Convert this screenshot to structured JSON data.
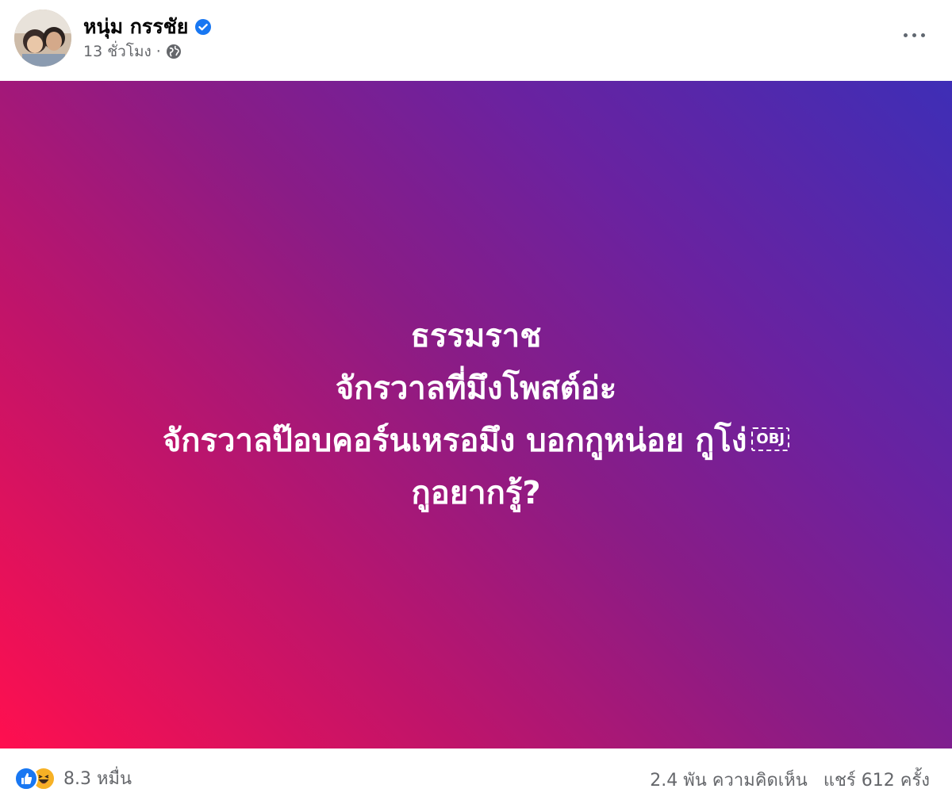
{
  "post": {
    "author": "หนุ่ม กรรชัย",
    "verified": true,
    "time": "13 ชั่วโมง",
    "separator": "·",
    "privacy_icon": "globe-icon",
    "more_icon": "more-horizontal-icon"
  },
  "media": {
    "background_colors": [
      "#ff0f4f",
      "#8a1c86",
      "#3e2eb6"
    ],
    "lines": [
      "ธรรมราช",
      "จักรวาลที่มึงโพสต์อ่ะ",
      "จักรวาลป๊อบคอร์นเหรอมึง บอกกูหน่อย กูโง่",
      "กูอยากรู้?"
    ],
    "obj_placeholder": "OBJ"
  },
  "footer": {
    "reaction_icons": [
      "like-icon",
      "haha-icon"
    ],
    "reaction_count": "8.3 หมื่น",
    "comments": "2.4 พัน ความคิดเห็น",
    "shares": "แชร์ 612 ครั้ง"
  },
  "colors": {
    "text_primary": "#050505",
    "text_secondary": "#65676b",
    "verified_blue": "#1877f2"
  }
}
